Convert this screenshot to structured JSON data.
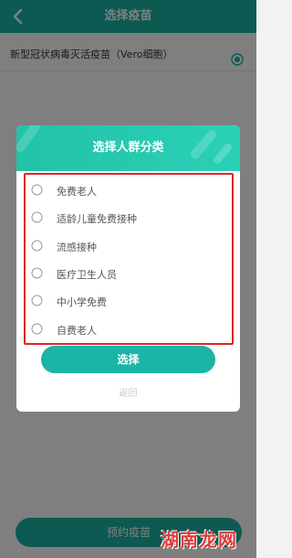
{
  "header": {
    "title": "选择疫苗",
    "back_icon": "chevron-left-icon"
  },
  "vaccine": {
    "name": "新型冠状病毒灭活疫苗（Vero细胞）",
    "selected": true
  },
  "bottom_button": {
    "label": "预约疫苗"
  },
  "modal": {
    "title": "选择人群分类",
    "options": [
      {
        "label": "免费老人",
        "checked": false
      },
      {
        "label": "适龄儿童免费接种",
        "checked": false
      },
      {
        "label": "流感接种",
        "checked": false
      },
      {
        "label": "医疗卫生人员",
        "checked": false
      },
      {
        "label": "中小学免费",
        "checked": false
      },
      {
        "label": "自费老人",
        "checked": false
      }
    ],
    "select_label": "选择",
    "return_label": "返回"
  },
  "watermark": {
    "text": "湖南龙网"
  },
  "colors": {
    "accent": "#1bb5a6",
    "highlight": "#e0242a"
  }
}
